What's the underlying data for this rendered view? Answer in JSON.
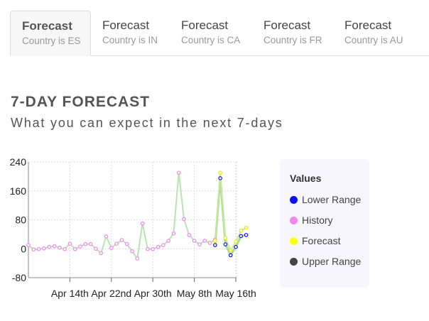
{
  "tabs": [
    {
      "title": "Forecast",
      "subtitle": "Country is ES",
      "active": true
    },
    {
      "title": "Forecast",
      "subtitle": "Country is IN",
      "active": false
    },
    {
      "title": "Forecast",
      "subtitle": "Country is CA",
      "active": false
    },
    {
      "title": "Forecast",
      "subtitle": "Country is FR",
      "active": false
    },
    {
      "title": "Forecast",
      "subtitle": "Country is AU",
      "active": false
    }
  ],
  "header": {
    "title": "7-DAY FORECAST",
    "subtitle": "What you can expect in the next 7-days"
  },
  "legend": {
    "title": "Values",
    "items": [
      {
        "label": "Lower Range",
        "color": "#1010ee"
      },
      {
        "label": "History",
        "color": "#ee88ee"
      },
      {
        "label": "Forecast",
        "color": "#ffff11"
      },
      {
        "label": "Upper Range",
        "color": "#444444"
      }
    ]
  },
  "chart_data": {
    "type": "line",
    "ylim": [
      -80,
      240
    ],
    "yticks": [
      240,
      160,
      80,
      0,
      -80
    ],
    "xticks": [
      "Apr 14th",
      "Apr 22nd",
      "Apr 30th",
      "May 8th",
      "May 16th"
    ],
    "x_start": "Apr 6",
    "grid": true,
    "series": [
      {
        "name": "History",
        "color": "#ee88ee",
        "values": [
          10,
          -2,
          -1,
          1,
          5,
          7,
          3,
          -1,
          14,
          -1,
          6,
          13,
          13,
          0,
          -12,
          34,
          2,
          14,
          24,
          13,
          -7,
          -27,
          70,
          -1,
          -1,
          5,
          10,
          22,
          42,
          210,
          82,
          38,
          22,
          12,
          22,
          16,
          25
        ]
      },
      {
        "name": "Lower Range",
        "color": "#1010ee",
        "values": [
          10,
          195,
          12,
          -18,
          5,
          35,
          38
        ]
      },
      {
        "name": "Forecast",
        "color": "#ffff11",
        "values": [
          22,
          210,
          30,
          -5,
          20,
          50,
          58
        ]
      }
    ]
  }
}
